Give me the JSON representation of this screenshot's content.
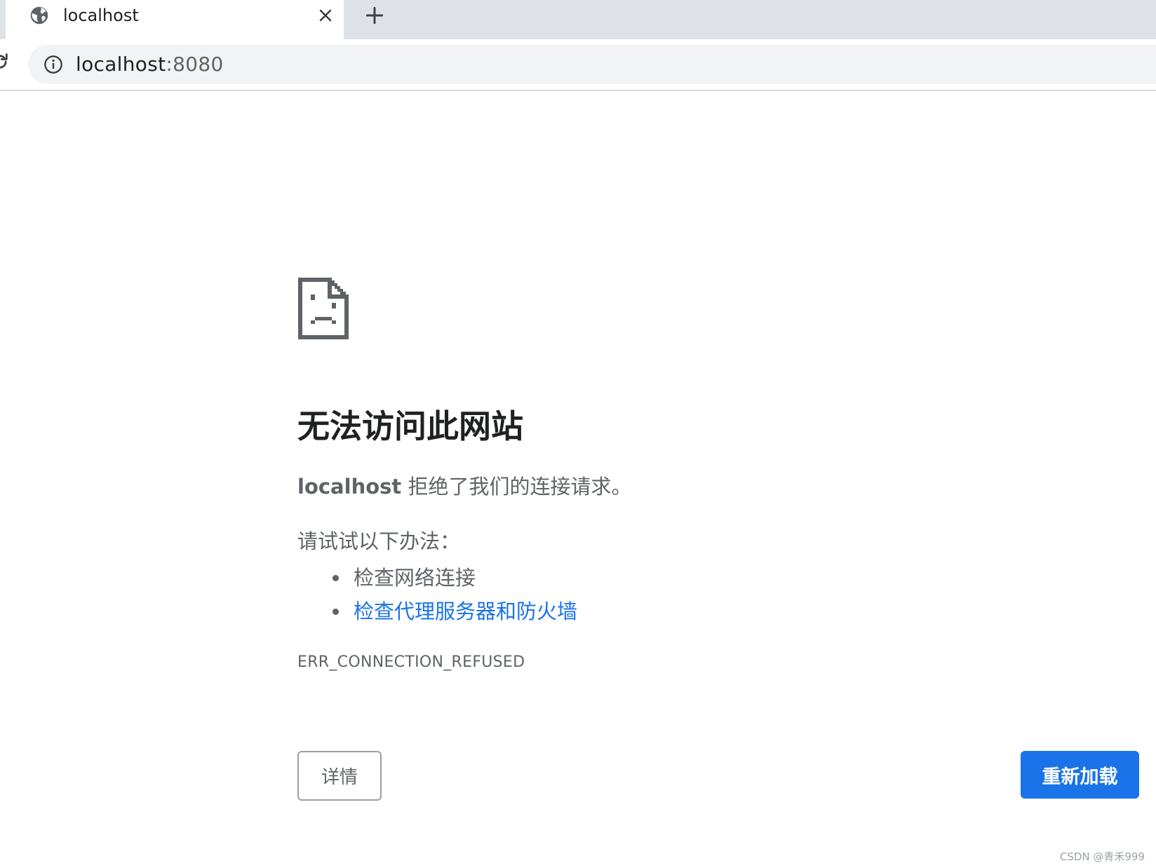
{
  "browser": {
    "tab": {
      "title": "localhost",
      "favicon": "globe-icon"
    },
    "new_tab_icon": "plus-icon",
    "close_icon": "close-icon",
    "reload_icon": "reload-icon",
    "omnibox": {
      "info_icon": "info-icon",
      "host": "localhost",
      "port": ":8080"
    }
  },
  "error": {
    "icon": "sad-page-icon",
    "title": "无法访问此网站",
    "host": "localhost",
    "description": " 拒绝了我们的连接请求。",
    "suggestions_heading": "请试试以下办法：",
    "suggestions": [
      {
        "text": "检查网络连接",
        "link": false
      },
      {
        "text": "检查代理服务器和防火墙",
        "link": true
      }
    ],
    "code": "ERR_CONNECTION_REFUSED",
    "details_label": "详情",
    "reload_label": "重新加载"
  },
  "watermark": "CSDN @青禾999",
  "colors": {
    "tabstrip": "#dee1e6",
    "omnibox": "#f1f3f4",
    "text_primary": "#202124",
    "text_secondary": "#5f6368",
    "link": "#1a73e8",
    "button_primary": "#1a73e8"
  }
}
